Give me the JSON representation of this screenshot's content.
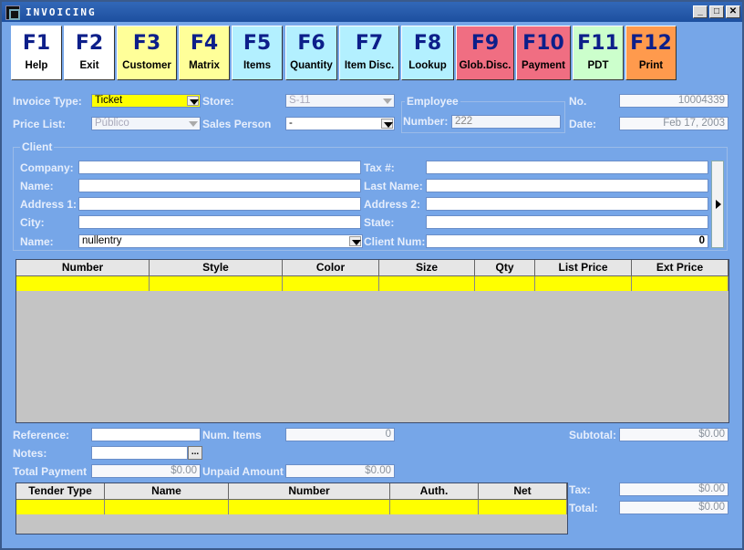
{
  "window": {
    "title": "INVOICING",
    "minimize_icon": "minimize-icon",
    "maximize_icon": "maximize-icon",
    "close_icon": "close-icon"
  },
  "fkeys": [
    {
      "key": "F1",
      "label": "Help",
      "bg": "#ffffff"
    },
    {
      "key": "F2",
      "label": "Exit",
      "bg": "#ffffff"
    },
    {
      "key": "F3",
      "label": "Customer",
      "bg": "#ffff99"
    },
    {
      "key": "F4",
      "label": "Matrix",
      "bg": "#ffff99"
    },
    {
      "key": "F5",
      "label": "Items",
      "bg": "#b3f0ff"
    },
    {
      "key": "F6",
      "label": "Quantity",
      "bg": "#b3f0ff"
    },
    {
      "key": "F7",
      "label": "Item Disc.",
      "bg": "#b3f0ff"
    },
    {
      "key": "F8",
      "label": "Lookup",
      "bg": "#b3f0ff"
    },
    {
      "key": "F9",
      "label": "Glob.Disc.",
      "bg": "#f06e82"
    },
    {
      "key": "F10",
      "label": "Payment",
      "bg": "#f06e82"
    },
    {
      "key": "F11",
      "label": "PDT",
      "bg": "#ccffcc"
    },
    {
      "key": "F12",
      "label": "Print",
      "bg": "#ff9a4d"
    }
  ],
  "header": {
    "invoice_type_label": "Invoice Type:",
    "invoice_type_value": "Ticket",
    "price_list_label": "Price List:",
    "price_list_value": "Público",
    "store_label": "Store:",
    "store_value": "S-11",
    "sales_person_label": "Sales Person",
    "sales_person_value": "-",
    "employee_group": "Employee",
    "number_label": "Number:",
    "number_value": "222",
    "no_label": "No.",
    "no_value": "10004339",
    "date_label": "Date:",
    "date_value": "Feb 17, 2003"
  },
  "client": {
    "group": "Client",
    "company_label": "Company:",
    "name_label": "Name:",
    "address1_label": "Address 1:",
    "city_label": "City:",
    "name2_label": "Name:",
    "name2_value": "nullentry",
    "tax_label": "Tax #:",
    "lastname_label": "Last Name:",
    "address2_label": "Address 2:",
    "state_label": "State:",
    "clientnum_label": "Client Num:",
    "clientnum_value": "0"
  },
  "items_grid": {
    "columns": [
      "Number",
      "Style",
      "Color",
      "Size",
      "Qty",
      "List Price",
      "Ext Price"
    ]
  },
  "summary": {
    "reference_label": "Reference:",
    "notes_label": "Notes:",
    "notes_button": "...",
    "total_payment_label": "Total Payment",
    "total_payment_value": "$0.00",
    "num_items_label": "Num. Items",
    "num_items_value": "0",
    "unpaid_label": "Unpaid Amount",
    "unpaid_value": "$0.00",
    "subtotal_label": "Subtotal:",
    "subtotal_value": "$0.00",
    "tax_label": "Tax:",
    "tax_value": "$0.00",
    "total_label": "Total:",
    "total_value": "$0.00"
  },
  "tender_grid": {
    "columns": [
      "Tender Type",
      "Name",
      "Number",
      "Auth.",
      "Net"
    ]
  }
}
